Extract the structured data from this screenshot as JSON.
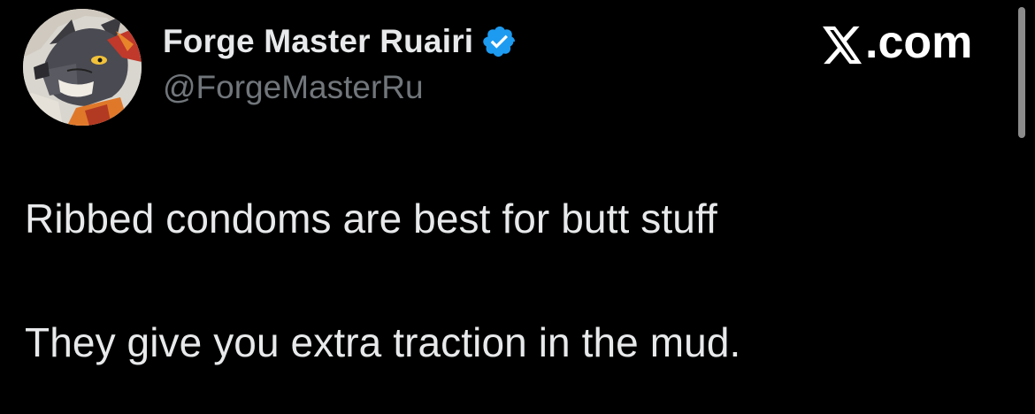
{
  "author": {
    "display_name": "Forge Master Ruairi",
    "handle": "@ForgeMasterRu",
    "verified": true,
    "avatar_icon": "wolf-character-avatar"
  },
  "brand": {
    "text": ".com",
    "logo_icon": "x-logo-icon"
  },
  "tweet": {
    "lines": [
      "Ribbed condoms are best for butt stuff",
      "They give you extra traction in the mud."
    ]
  },
  "colors": {
    "background": "#000000",
    "text_primary": "#e7e9ea",
    "text_secondary": "#71767b",
    "verified_badge": "#1d9bf0"
  }
}
